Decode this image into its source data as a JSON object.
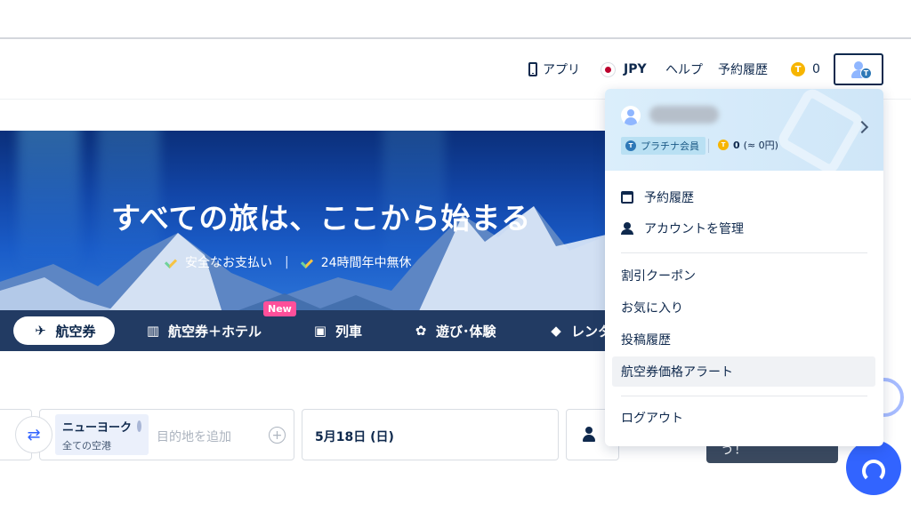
{
  "header": {
    "app_label": "アプリ",
    "currency_label": "JPY",
    "help_label": "ヘルプ",
    "history_label": "予約履歴",
    "coin_icon_letter": "T",
    "coin_count": "0",
    "avatar_badge_letter": "T"
  },
  "hero": {
    "title": "すべての旅は、ここから始まる",
    "features": [
      "安全なお支払い",
      "24時間年中無休"
    ],
    "separator": "|"
  },
  "tabs": {
    "items": [
      {
        "label": "航空券",
        "icon": "plane-icon"
      },
      {
        "label": "航空券＋ホテル",
        "icon": "hotel-icon"
      },
      {
        "label": "列車",
        "icon": "train-icon"
      },
      {
        "label": "遊び･体験",
        "icon": "activity-icon"
      },
      {
        "label": "レンタ",
        "icon": "car-icon"
      }
    ],
    "new_badge": "New"
  },
  "search": {
    "destination_name": "ニューヨーク",
    "destination_sub": "全ての空港",
    "add_destination_placeholder": "目的地を追加",
    "date": "5月18日 (日)",
    "search_button_label": "う！"
  },
  "dropdown": {
    "member_tier": "プラチナ会員",
    "tier_icon_letter": "T",
    "coin_icon_letter": "T",
    "points_value": "0",
    "points_equiv": "(≈ 0円)",
    "items": [
      {
        "label": "予約履歴",
        "icon": "calendar-icon"
      },
      {
        "label": "アカウントを管理",
        "icon": "user-icon"
      },
      {
        "label": "割引クーポン"
      },
      {
        "label": "お気に入り"
      },
      {
        "label": "投稿履歴"
      },
      {
        "label": "航空券価格アラート"
      },
      {
        "label": "ログアウト"
      }
    ]
  },
  "colors": {
    "brand_blue": "#3264ff",
    "navy": "#0f294d",
    "tab_bar": "#223b63",
    "new_badge": "#ff4f9a",
    "coin": "#f7b500"
  }
}
